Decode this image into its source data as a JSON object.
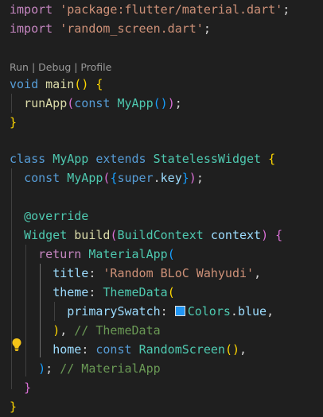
{
  "import1": {
    "kw": "import",
    "path": "'package:flutter/material.dart'",
    "semi": ";"
  },
  "import2": {
    "kw": "import",
    "path": "'random_screen.dart'",
    "semi": ";"
  },
  "codelens": {
    "run": "Run",
    "sep1": " | ",
    "debug": "Debug",
    "sep2": " | ",
    "profile": "Profile"
  },
  "main_sig": {
    "ret": "void",
    "name": "main",
    "open": "(",
    "close": ")",
    "brace": "{"
  },
  "run_app": {
    "fn": "runApp",
    "open": "(",
    "kw": "const",
    "cls": "MyApp",
    "inner": "()",
    "close": ")",
    "semi": ";"
  },
  "main_close": "}",
  "class_decl": {
    "kw": "class",
    "name": "MyApp",
    "extends": "extends",
    "base": "StatelessWidget",
    "brace": "{"
  },
  "ctor": {
    "kw": "const",
    "name": "MyApp",
    "p_open": "(",
    "b_open": "{",
    "super": "super",
    "dot": ".",
    "key": "key",
    "b_close": "}",
    "p_close": ")",
    "semi": ";"
  },
  "annotation": "@override",
  "build_sig": {
    "ret": "Widget",
    "name": "build",
    "open": "(",
    "ptype": "BuildContext",
    "pname": "context",
    "close": ")",
    "brace": "{"
  },
  "return_line": {
    "kw": "return",
    "cls": "MaterialApp",
    "open": "("
  },
  "title_line": {
    "prop": "title",
    "colon": ":",
    "value": "'Random BLoC Wahyudi'",
    "comma": ","
  },
  "theme_line": {
    "prop": "theme",
    "colon": ":",
    "cls": "ThemeData",
    "open": "("
  },
  "swatch_line": {
    "prop": "primarySwatch",
    "colon": ":",
    "swatch_color": "#2196f3",
    "cls": "Colors",
    "dot": ".",
    "member": "blue",
    "comma": ","
  },
  "theme_close": {
    "close": ")",
    "comma": ",",
    "comment": "// ThemeData"
  },
  "home_line": {
    "prop": "home",
    "colon": ":",
    "kw": "const",
    "cls": "RandomScreen",
    "inner": "()",
    "comma": ","
  },
  "app_close": {
    "close": ")",
    "semi": ";",
    "comment": "// MaterialApp"
  },
  "build_close": "}",
  "class_close": "}",
  "icons": {
    "lightbulb": "lightbulb-icon",
    "color_swatch": "color-swatch-icon"
  }
}
